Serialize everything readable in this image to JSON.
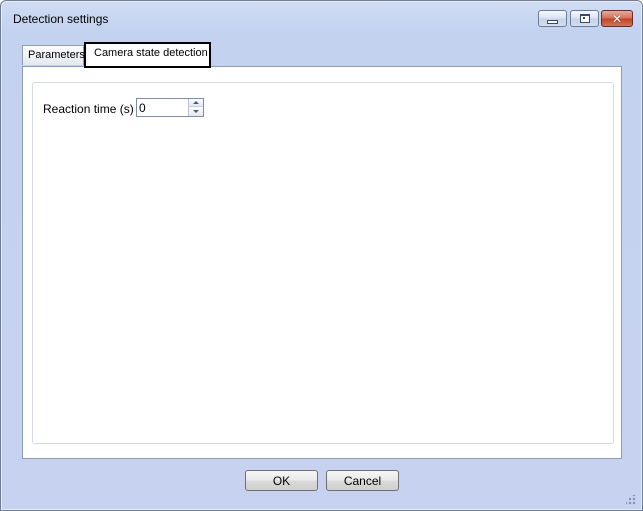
{
  "window": {
    "title": "Detection settings"
  },
  "title_controls": {
    "minimize_icon": "minimize-icon",
    "maximize_icon": "maximize-icon",
    "close_icon": "close-icon",
    "close_glyph": "✕"
  },
  "tabs": [
    {
      "label": "Parameters",
      "active": false
    },
    {
      "label": "Camera state detection",
      "active": true
    }
  ],
  "form": {
    "reaction_time": {
      "label": "Reaction time (s)",
      "value": "0"
    }
  },
  "buttons": {
    "ok_label": "OK",
    "cancel_label": "Cancel"
  },
  "colors": {
    "window_frame": "#c7d2f0",
    "close_button": "#c0452a",
    "active_tab_outline": "#000000"
  }
}
